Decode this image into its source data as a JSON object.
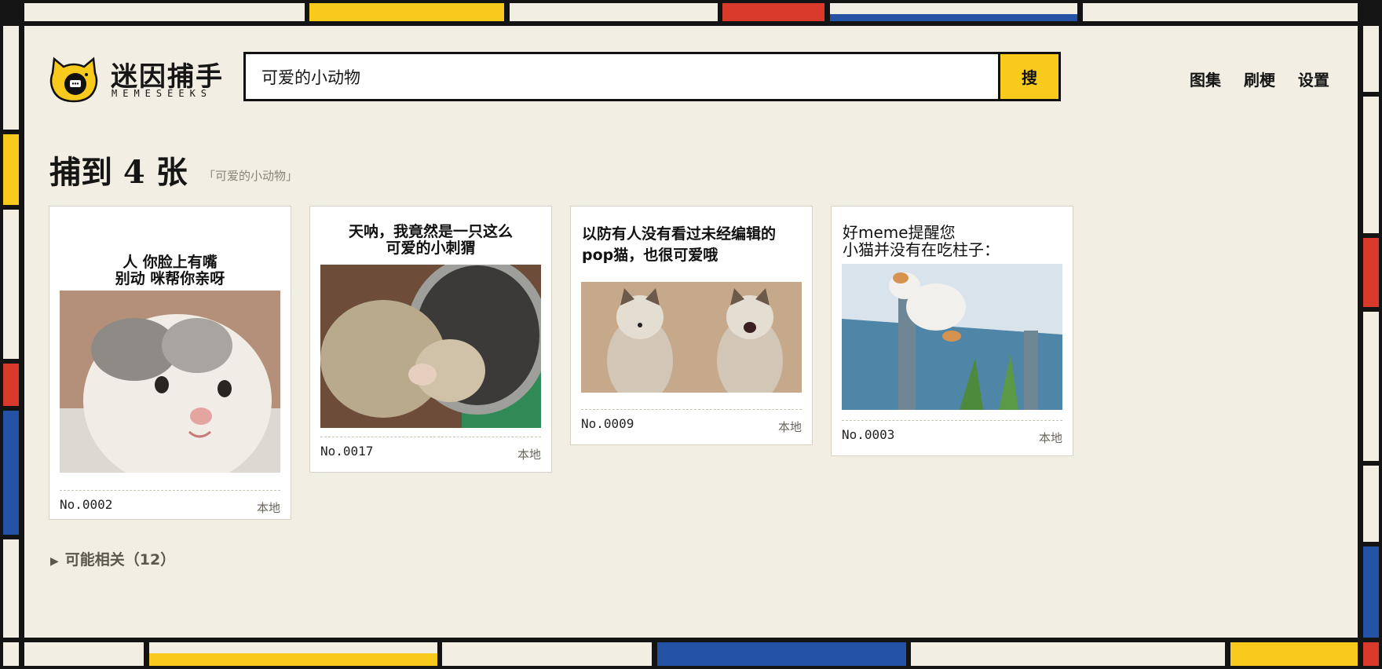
{
  "brand": {
    "name_cn": "迷因捕手",
    "name_en": "MEMESEEKS"
  },
  "search": {
    "value": "可爱的小动物",
    "button_label": "搜"
  },
  "nav": {
    "gallery": "图集",
    "browse": "刷梗",
    "settings": "设置"
  },
  "results": {
    "title": "捕到 4 张",
    "query_tag": "「可爱的小动物」"
  },
  "cards": [
    {
      "caption": "人  你脸上有嘴\n别动  咪帮你亲呀",
      "id": "No.0002",
      "source": "本地"
    },
    {
      "caption": "天呐，我竟然是一只这么\n可爱的小刺猬",
      "id": "No.0017",
      "source": "本地"
    },
    {
      "caption": "以防有人没有看过未经编辑的\npop猫，也很可爱哦",
      "id": "No.0009",
      "source": "本地"
    },
    {
      "caption": "好meme提醒您\n小猫并没有在吃柱子：",
      "id": "No.0003",
      "source": "本地"
    }
  ],
  "related": {
    "label": "可能相关（12）"
  },
  "colors": {
    "yellow": "#f7ca1c",
    "red": "#d93a2b",
    "blue": "#2452a4",
    "cream": "#f2eee4",
    "frame": "#141414"
  }
}
